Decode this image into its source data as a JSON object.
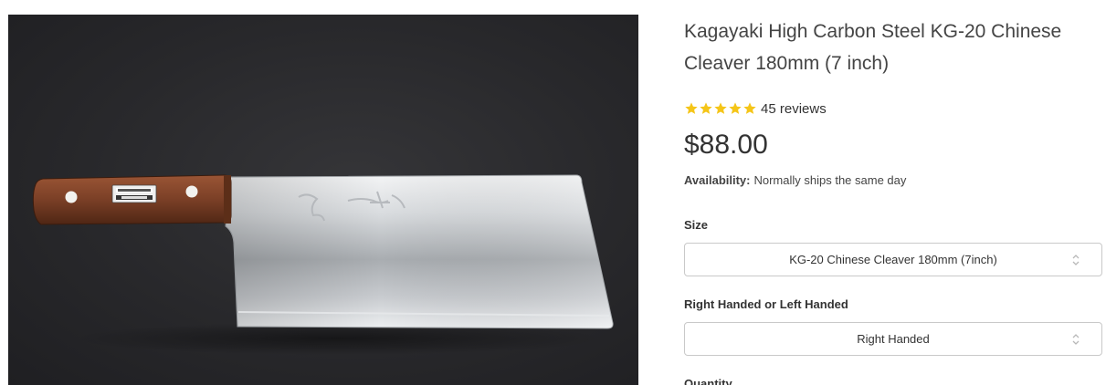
{
  "product": {
    "title": "Kagayaki High Carbon Steel KG-20 Chinese Cleaver 180mm (7 inch)",
    "rating": 5,
    "reviews_text": "45 reviews",
    "price": "$88.00",
    "availability_label": "Availability:",
    "availability_value": "Normally ships the same day"
  },
  "options": {
    "size_label": "Size",
    "size_value": "KG-20 Chinese Cleaver 180mm (7inch)",
    "hand_label": "Right Handed or Left Handed",
    "hand_value": "Right Handed",
    "quantity_label": "Quantity"
  },
  "colors": {
    "star": "#f5c518",
    "image_background": "#2a2a2d",
    "handle": "#7a3f26"
  },
  "icons": {
    "star": "star-icon",
    "select_arrows": "chevron-up-down-icon"
  }
}
